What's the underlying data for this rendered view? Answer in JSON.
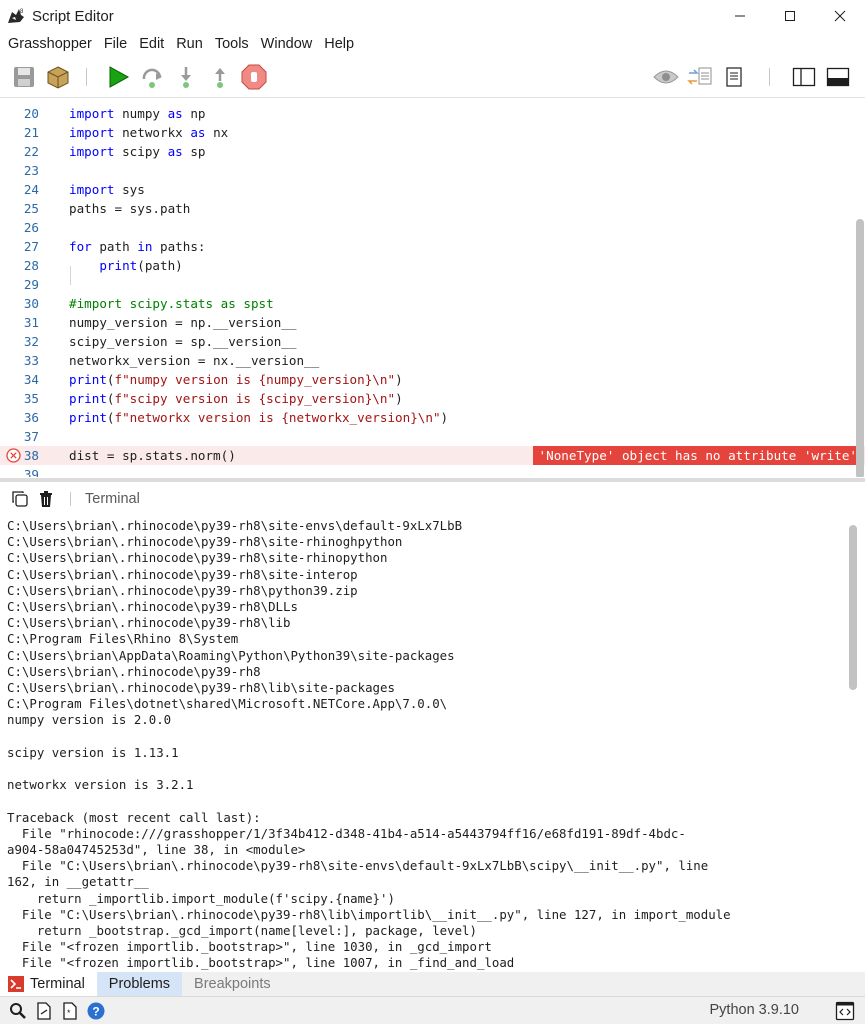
{
  "window": {
    "title": "Script Editor",
    "app_icon": "rhino-icon",
    "controls": [
      "minimize-icon",
      "maximize-icon",
      "close-icon"
    ]
  },
  "menu": [
    "Grasshopper",
    "File",
    "Edit",
    "Run",
    "Tools",
    "Window",
    "Help"
  ],
  "toolbar": {
    "left_icons": [
      "save-icon",
      "package-icon",
      "run-icon",
      "step-over-icon",
      "step-into-icon",
      "step-out-icon",
      "stop-icon"
    ],
    "right_icons": [
      "watch-icon",
      "compare-icon",
      "notes-icon",
      "panel-left-icon",
      "panel-bottom-icon"
    ]
  },
  "editor": {
    "lines": [
      {
        "n": "20",
        "code": "import numpy as np"
      },
      {
        "n": "21",
        "code": "import networkx as nx"
      },
      {
        "n": "22",
        "code": "import scipy as sp"
      },
      {
        "n": "23",
        "code": ""
      },
      {
        "n": "24",
        "code": "import sys"
      },
      {
        "n": "25",
        "code": "paths = sys.path"
      },
      {
        "n": "26",
        "code": ""
      },
      {
        "n": "27",
        "code": "for path in paths:"
      },
      {
        "n": "28",
        "code": "    print(path)"
      },
      {
        "n": "29",
        "code": ""
      },
      {
        "n": "30",
        "code": "#import scipy.stats as spst"
      },
      {
        "n": "31",
        "code": "numpy_version = np.__version__"
      },
      {
        "n": "32",
        "code": "scipy_version = sp.__version__"
      },
      {
        "n": "33",
        "code": "networkx_version = nx.__version__"
      },
      {
        "n": "34",
        "code": "print(f\"numpy version is {numpy_version}\\n\")"
      },
      {
        "n": "35",
        "code": "print(f\"scipy version is {scipy_version}\\n\")"
      },
      {
        "n": "36",
        "code": "print(f\"networkx version is {networkx_version}\\n\")"
      },
      {
        "n": "37",
        "code": ""
      },
      {
        "n": "38",
        "code": "dist = sp.stats.norm()"
      },
      {
        "n": "39",
        "code": ""
      }
    ],
    "error_message": "'NoneType' object has no attribute 'write'",
    "colors": {
      "keyword": "#0000ff",
      "string": "#a31515",
      "comment": "#008000",
      "line_number": "#2b6aa8",
      "error": "#e5443c"
    }
  },
  "terminal_panel": {
    "title": "Terminal",
    "icons": [
      "copy-icon",
      "trash-icon"
    ],
    "output": [
      "C:\\Users\\brian\\.rhinocode\\py39-rh8\\site-envs\\default-9xLx7LbB",
      "C:\\Users\\brian\\.rhinocode\\py39-rh8\\site-rhinoghpython",
      "C:\\Users\\brian\\.rhinocode\\py39-rh8\\site-rhinopython",
      "C:\\Users\\brian\\.rhinocode\\py39-rh8\\site-interop",
      "C:\\Users\\brian\\.rhinocode\\py39-rh8\\python39.zip",
      "C:\\Users\\brian\\.rhinocode\\py39-rh8\\DLLs",
      "C:\\Users\\brian\\.rhinocode\\py39-rh8\\lib",
      "C:\\Program Files\\Rhino 8\\System",
      "C:\\Users\\brian\\AppData\\Roaming\\Python\\Python39\\site-packages",
      "C:\\Users\\brian\\.rhinocode\\py39-rh8",
      "C:\\Users\\brian\\.rhinocode\\py39-rh8\\lib\\site-packages",
      "C:\\Program Files\\dotnet\\shared\\Microsoft.NETCore.App\\7.0.0\\",
      "numpy version is 2.0.0",
      "",
      "scipy version is 1.13.1",
      "",
      "networkx version is 3.2.1",
      "",
      "Traceback (most recent call last):",
      "  File \"rhinocode:///grasshopper/1/3f34b412-d348-41b4-a514-a5443794ff16/e68fd191-89df-4bdc-",
      "a904-58a04745253d\", line 38, in <module>",
      "  File \"C:\\Users\\brian\\.rhinocode\\py39-rh8\\site-envs\\default-9xLx7LbB\\scipy\\__init__.py\", line",
      "162, in __getattr__",
      "    return _importlib.import_module(f'scipy.{name}')",
      "  File \"C:\\Users\\brian\\.rhinocode\\py39-rh8\\lib\\importlib\\__init__.py\", line 127, in import_module",
      "    return _bootstrap._gcd_import(name[level:], package, level)",
      "  File \"<frozen importlib._bootstrap>\", line 1030, in _gcd_import",
      "  File \"<frozen importlib._bootstrap>\", line 1007, in _find_and_load"
    ]
  },
  "bottom_tabs": [
    {
      "label": "Terminal",
      "icon": "terminal-icon",
      "state": "active"
    },
    {
      "label": "Problems",
      "state": "hover"
    },
    {
      "label": "Breakpoints",
      "state": "inactive"
    }
  ],
  "statusbar": {
    "icons": [
      "search-icon",
      "document-icon",
      "new-document-icon",
      "help-icon"
    ],
    "python_version": "Python 3.9.10",
    "right_icon": "code-icon"
  }
}
